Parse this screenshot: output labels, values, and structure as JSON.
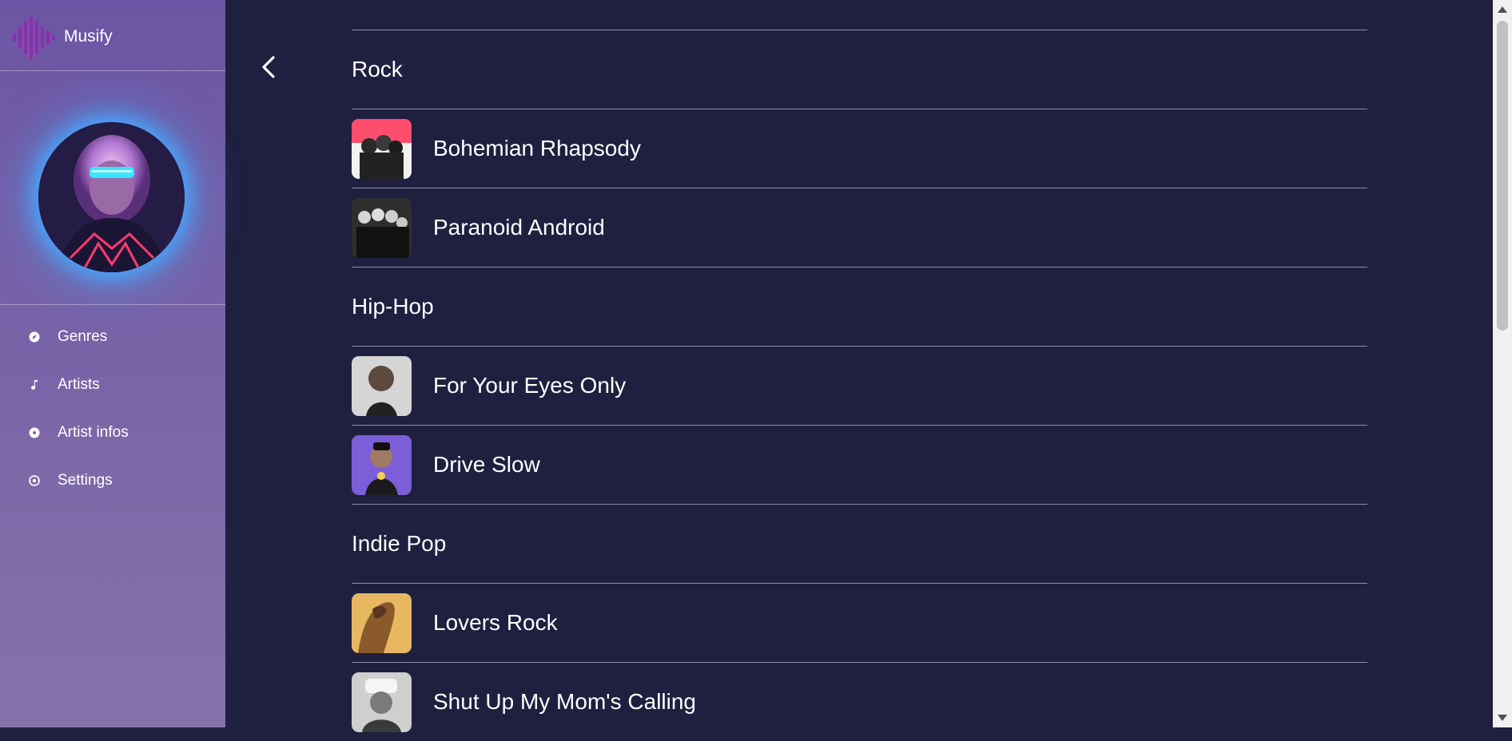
{
  "app": {
    "name": "Musify"
  },
  "sidebar": {
    "items": [
      {
        "label": "Genres",
        "icon": "compass-icon"
      },
      {
        "label": "Artists",
        "icon": "music-note-icon"
      },
      {
        "label": "Artist infos",
        "icon": "disc-icon"
      },
      {
        "label": "Settings",
        "icon": "gear-icon"
      }
    ]
  },
  "sections": [
    {
      "genre": "Rock",
      "songs": [
        {
          "title": "Bohemian Rhapsody",
          "thumb_color": "#8a5a62"
        },
        {
          "title": "Paranoid Android",
          "thumb_color": "#3a3a3a"
        }
      ]
    },
    {
      "genre": "Hip-Hop",
      "songs": [
        {
          "title": "For Your Eyes Only",
          "thumb_color": "#57575a"
        },
        {
          "title": "Drive Slow",
          "thumb_color": "#7b5ed8"
        }
      ]
    },
    {
      "genre": "Indie Pop",
      "songs": [
        {
          "title": "Lovers Rock",
          "thumb_color": "#c99a4a"
        },
        {
          "title": "Shut Up My Mom's Calling",
          "thumb_color": "#bdbdbd"
        }
      ]
    }
  ],
  "colors": {
    "background": "#1f1f3f",
    "sidebar_top": "#6c55a4",
    "sidebar_bottom": "#8672aa",
    "avatar_glow": "#47a8ff",
    "logo_accent": "#9b2bb6",
    "divider": "#8e8eaa"
  }
}
